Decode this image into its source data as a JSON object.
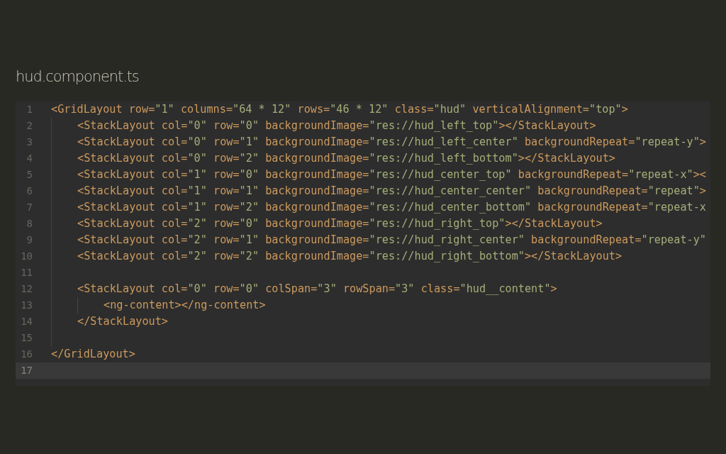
{
  "file_title": "hud.component.ts",
  "lines": [
    {
      "number": "1",
      "active": false,
      "tokens": [
        {
          "kind": "tag",
          "text": "<GridLayout row="
        },
        {
          "kind": "string",
          "text": "\"1\""
        },
        {
          "kind": "tag",
          "text": " columns="
        },
        {
          "kind": "string",
          "text": "\"64 * 12\""
        },
        {
          "kind": "tag",
          "text": " rows="
        },
        {
          "kind": "string",
          "text": "\"46 * 12\""
        },
        {
          "kind": "tag",
          "text": " class="
        },
        {
          "kind": "string",
          "text": "\"hud\""
        },
        {
          "kind": "tag",
          "text": " verticalAlignment="
        },
        {
          "kind": "string",
          "text": "\"top\""
        },
        {
          "kind": "tag",
          "text": ">"
        }
      ],
      "children": [
        {
          "number": "2",
          "active": false,
          "tokens": [
            {
              "kind": "tag",
              "text": "<StackLayout col="
            },
            {
              "kind": "string",
              "text": "\"0\""
            },
            {
              "kind": "tag",
              "text": " row="
            },
            {
              "kind": "string",
              "text": "\"0\""
            },
            {
              "kind": "tag",
              "text": " backgroundImage="
            },
            {
              "kind": "string",
              "text": "\"res://hud_left_top\""
            },
            {
              "kind": "tag",
              "text": "></StackLayout>"
            }
          ]
        },
        {
          "number": "3",
          "active": false,
          "tokens": [
            {
              "kind": "tag",
              "text": "<StackLayout col="
            },
            {
              "kind": "string",
              "text": "\"0\""
            },
            {
              "kind": "tag",
              "text": " row="
            },
            {
              "kind": "string",
              "text": "\"1\""
            },
            {
              "kind": "tag",
              "text": " backgroundImage="
            },
            {
              "kind": "string",
              "text": "\"res://hud_left_center\""
            },
            {
              "kind": "tag",
              "text": " backgroundRepeat="
            },
            {
              "kind": "string",
              "text": "\"repeat-y\""
            },
            {
              "kind": "tag",
              "text": ">"
            }
          ]
        },
        {
          "number": "4",
          "active": false,
          "tokens": [
            {
              "kind": "tag",
              "text": "<StackLayout col="
            },
            {
              "kind": "string",
              "text": "\"0\""
            },
            {
              "kind": "tag",
              "text": " row="
            },
            {
              "kind": "string",
              "text": "\"2\""
            },
            {
              "kind": "tag",
              "text": " backgroundImage="
            },
            {
              "kind": "string",
              "text": "\"res://hud_left_bottom\""
            },
            {
              "kind": "tag",
              "text": "></StackLayout>"
            }
          ]
        },
        {
          "number": "5",
          "active": false,
          "tokens": [
            {
              "kind": "tag",
              "text": "<StackLayout col="
            },
            {
              "kind": "string",
              "text": "\"1\""
            },
            {
              "kind": "tag",
              "text": " row="
            },
            {
              "kind": "string",
              "text": "\"0\""
            },
            {
              "kind": "tag",
              "text": " backgroundImage="
            },
            {
              "kind": "string",
              "text": "\"res://hud_center_top\""
            },
            {
              "kind": "tag",
              "text": " backgroundRepeat="
            },
            {
              "kind": "string",
              "text": "\"repeat-x\""
            },
            {
              "kind": "tag",
              "text": "><"
            }
          ]
        },
        {
          "number": "6",
          "active": false,
          "tokens": [
            {
              "kind": "tag",
              "text": "<StackLayout col="
            },
            {
              "kind": "string",
              "text": "\"1\""
            },
            {
              "kind": "tag",
              "text": " row="
            },
            {
              "kind": "string",
              "text": "\"1\""
            },
            {
              "kind": "tag",
              "text": " backgroundImage="
            },
            {
              "kind": "string",
              "text": "\"res://hud_center_center\""
            },
            {
              "kind": "tag",
              "text": " backgroundRepeat="
            },
            {
              "kind": "string",
              "text": "\"repeat\""
            },
            {
              "kind": "tag",
              "text": ">"
            }
          ]
        },
        {
          "number": "7",
          "active": false,
          "tokens": [
            {
              "kind": "tag",
              "text": "<StackLayout col="
            },
            {
              "kind": "string",
              "text": "\"1\""
            },
            {
              "kind": "tag",
              "text": " row="
            },
            {
              "kind": "string",
              "text": "\"2\""
            },
            {
              "kind": "tag",
              "text": " backgroundImage="
            },
            {
              "kind": "string",
              "text": "\"res://hud_center_bottom\""
            },
            {
              "kind": "tag",
              "text": " backgroundRepeat="
            },
            {
              "kind": "string",
              "text": "\"repeat-x"
            }
          ]
        },
        {
          "number": "8",
          "active": false,
          "tokens": [
            {
              "kind": "tag",
              "text": "<StackLayout col="
            },
            {
              "kind": "string",
              "text": "\"2\""
            },
            {
              "kind": "tag",
              "text": " row="
            },
            {
              "kind": "string",
              "text": "\"0\""
            },
            {
              "kind": "tag",
              "text": " backgroundImage="
            },
            {
              "kind": "string",
              "text": "\"res://hud_right_top\""
            },
            {
              "kind": "tag",
              "text": "></StackLayout>"
            }
          ]
        },
        {
          "number": "9",
          "active": false,
          "tokens": [
            {
              "kind": "tag",
              "text": "<StackLayout col="
            },
            {
              "kind": "string",
              "text": "\"2\""
            },
            {
              "kind": "tag",
              "text": " row="
            },
            {
              "kind": "string",
              "text": "\"1\""
            },
            {
              "kind": "tag",
              "text": " backgroundImage="
            },
            {
              "kind": "string",
              "text": "\"res://hud_right_center\""
            },
            {
              "kind": "tag",
              "text": " backgroundRepeat="
            },
            {
              "kind": "string",
              "text": "\"repeat-y\""
            }
          ]
        },
        {
          "number": "10",
          "active": false,
          "tokens": [
            {
              "kind": "tag",
              "text": "<StackLayout col="
            },
            {
              "kind": "string",
              "text": "\"2\""
            },
            {
              "kind": "tag",
              "text": " row="
            },
            {
              "kind": "string",
              "text": "\"2\""
            },
            {
              "kind": "tag",
              "text": " backgroundImage="
            },
            {
              "kind": "string",
              "text": "\"res://hud_right_bottom\""
            },
            {
              "kind": "tag",
              "text": "></StackLayout>"
            }
          ]
        },
        {
          "number": "11",
          "active": false
        },
        {
          "number": "12",
          "active": false,
          "tokens": [
            {
              "kind": "tag",
              "text": "<StackLayout col="
            },
            {
              "kind": "string",
              "text": "\"0\""
            },
            {
              "kind": "tag",
              "text": " row="
            },
            {
              "kind": "string",
              "text": "\"0\""
            },
            {
              "kind": "tag",
              "text": " colSpan="
            },
            {
              "kind": "string",
              "text": "\"3\""
            },
            {
              "kind": "tag",
              "text": " rowSpan="
            },
            {
              "kind": "string",
              "text": "\"3\""
            },
            {
              "kind": "tag",
              "text": " class="
            },
            {
              "kind": "string",
              "text": "\"hud__content\""
            },
            {
              "kind": "tag",
              "text": ">"
            }
          ],
          "children": [
            {
              "number": "13",
              "active": false,
              "tokens": [
                {
                  "kind": "tag",
                  "text": "<ng-content></ng-content>"
                }
              ]
            }
          ]
        },
        {
          "number": "14",
          "active": false,
          "tokens": [
            {
              "kind": "tag",
              "text": "</StackLayout>"
            }
          ]
        },
        {
          "number": "15",
          "active": false
        }
      ]
    },
    {
      "number": "16",
      "active": false,
      "tokens": [
        {
          "kind": "tag",
          "text": "</GridLayout>"
        }
      ]
    },
    {
      "number": "17",
      "active": true
    }
  ]
}
